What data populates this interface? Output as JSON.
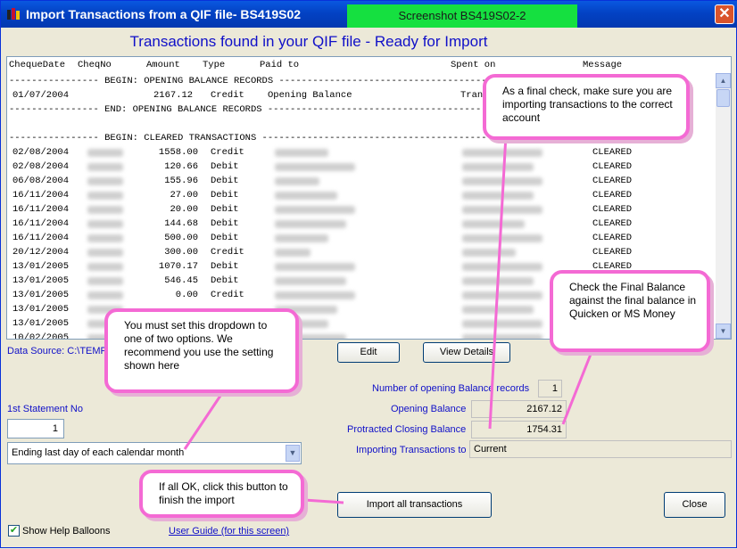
{
  "window": {
    "title": "Import Transactions from a QIF file- BS419S02",
    "screenshot_badge": "Screenshot BS419S02-2",
    "close_glyph": "✕",
    "icon": "qif-app-icon"
  },
  "heading": "Transactions found in your QIF file - Ready for Import",
  "columns": [
    "ChequeDate",
    "CheqNo",
    "Amount",
    "Type",
    "Paid to",
    "Spent on",
    "Message"
  ],
  "sections": {
    "opening_begin": "---------------- BEGIN: OPENING BALANCE RECORDS -------------------------------------------------------------------",
    "opening_end": "---------------- END: OPENING BALANCE RECORDS -------------------------------------------------------------------",
    "cleared_begin": "---------------- BEGIN: CLEARED TRANSACTIONS ------------------------------------------------------------------"
  },
  "opening_row": {
    "date": "01/07/2004",
    "amount": "2167.12",
    "type": "Credit",
    "paid_to": "Opening Balance",
    "spent_on": "Tran"
  },
  "transactions": [
    {
      "date": "02/08/2004",
      "amount": "1558.00",
      "type": "Credit",
      "message": "CLEARED"
    },
    {
      "date": "02/08/2004",
      "amount": "120.66",
      "type": "Debit",
      "message": "CLEARED"
    },
    {
      "date": "06/08/2004",
      "amount": "155.96",
      "type": "Debit",
      "message": "CLEARED"
    },
    {
      "date": "16/11/2004",
      "amount": "27.00",
      "type": "Debit",
      "message": "CLEARED"
    },
    {
      "date": "16/11/2004",
      "amount": "20.00",
      "type": "Debit",
      "message": "CLEARED"
    },
    {
      "date": "16/11/2004",
      "amount": "144.68",
      "type": "Debit",
      "message": "CLEARED"
    },
    {
      "date": "16/11/2004",
      "amount": "500.00",
      "type": "Debit",
      "message": "CLEARED"
    },
    {
      "date": "20/12/2004",
      "amount": "300.00",
      "type": "Credit",
      "message": "CLEARED"
    },
    {
      "date": "13/01/2005",
      "amount": "1070.17",
      "type": "Debit",
      "message": "CLEARED"
    },
    {
      "date": "13/01/2005",
      "amount": "546.45",
      "type": "Debit",
      "message": ""
    },
    {
      "date": "13/01/2005",
      "amount": "0.00",
      "type": "Credit",
      "message": ""
    },
    {
      "date": "13/01/2005",
      "amount": "",
      "type": "",
      "message": ""
    },
    {
      "date": "13/01/2005",
      "amount": "",
      "type": "",
      "message": ""
    },
    {
      "date": "10/02/2005",
      "amount": "",
      "type": "",
      "message": ""
    }
  ],
  "scroll": {
    "up": "▲",
    "down": "▼"
  },
  "data_source": "Data Source: C:\\TEMP",
  "buttons": {
    "edit": "Edit",
    "view_details": "View Details",
    "import_all": "Import all transactions",
    "close": "Close"
  },
  "fields": {
    "opening_count_label": "Number of opening Balance records",
    "opening_count_value": "1",
    "opening_balance_label": "Opening Balance",
    "opening_balance_value": "2167.12",
    "closing_balance_label": "Protracted Closing Balance",
    "closing_balance_value": "1754.31",
    "importing_to_label": "Importing Transactions to",
    "importing_to_value": "Current"
  },
  "statement": {
    "label": "1st Statement No",
    "value": "1"
  },
  "period_select": {
    "selected": "Ending last day of each calendar month",
    "arrow": "▼"
  },
  "balloons": {
    "final_check": "As a final check, make sure you are importing transactions to the correct account",
    "balance_check": "Check the Final Balance against the final balance in Quicken or MS Money",
    "dropdown": "You must set this dropdown to one of two options. We recommend you use the setting shown here",
    "import": "If all OK, click this button to finish the import"
  },
  "help_balloons": {
    "label": "Show Help Balloons",
    "checked_glyph": "✔"
  },
  "user_guide": "User Guide (for this screen)",
  "colors": {
    "title_bar": "#0342c4",
    "label_blue": "#1010c8",
    "balloon_border": "#f46ad4",
    "badge_green": "#15e040"
  }
}
